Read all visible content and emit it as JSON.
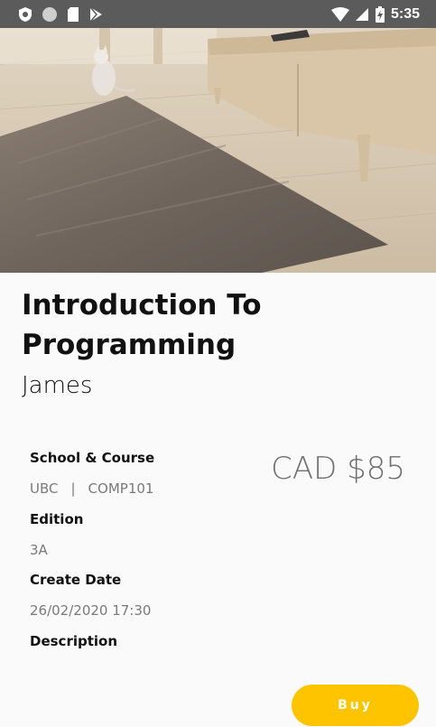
{
  "status_bar": {
    "time": "5:35"
  },
  "listing": {
    "title_line1": "Introduction To",
    "title_line2": "Programming",
    "author": "James",
    "price": "CAD $85",
    "school_course_label": "School & Course",
    "school": "UBC",
    "separator": "|",
    "course": "COMP101",
    "edition_label": "Edition",
    "edition": "3A",
    "create_date_label": "Create Date",
    "create_date": "26/02/2020 17:30",
    "description_label": "Description",
    "buy_label": "Buy"
  },
  "colors": {
    "accent": "#ffc400",
    "status_bar": "#5b5b5b"
  }
}
